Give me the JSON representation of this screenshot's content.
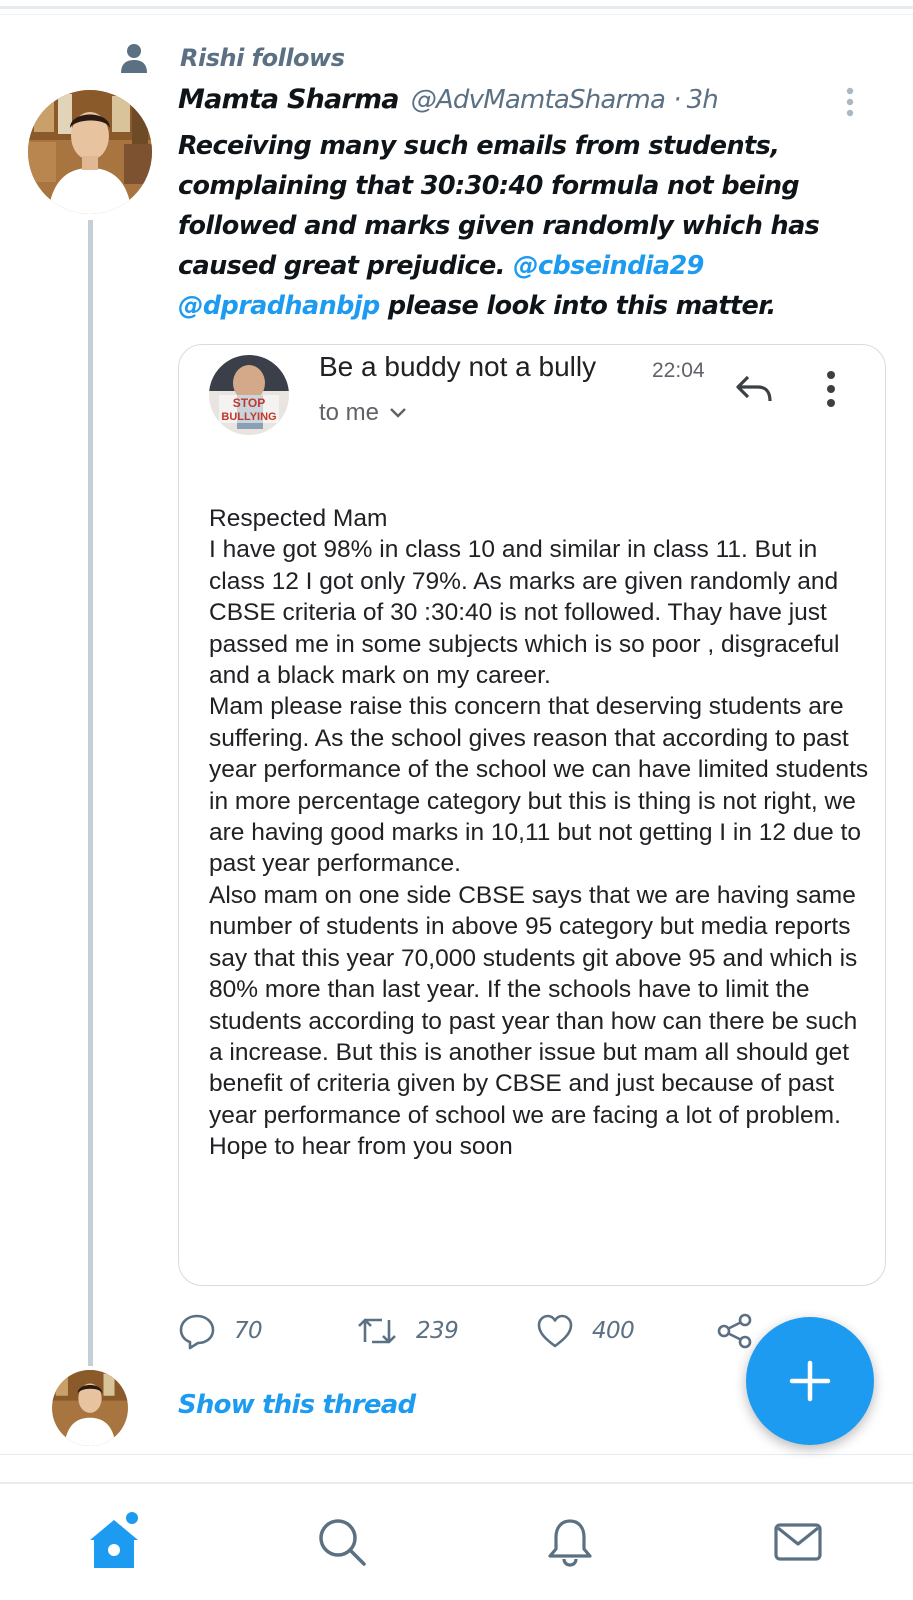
{
  "social_context": {
    "text": "Rishi follows",
    "icon": "person-icon"
  },
  "tweet": {
    "author_name": "Mamta Sharma",
    "author_handle": "@AdvMamtaSharma",
    "separator": "·",
    "time": "3h",
    "text_before": "Receiving many such emails from students, complaining that 30:30:40 formula not being followed and marks given randomly which has caused great prejudice. ",
    "mention_1": "@cbseindia29",
    "text_between": " ",
    "mention_2": "@dpradhanbjp",
    "text_after": " please look into this matter.",
    "accent_color": "#1d9bf0"
  },
  "email_card": {
    "avatar_text_line1": "STOP",
    "avatar_text_line2": "BULLYING",
    "subject": "Be a buddy not a bully",
    "time": "22:04",
    "to": "to me",
    "body": [
      "Respected Mam",
      "I have got 98% in class 10 and similar in class 11. But in class 12 I got only 79%. As marks are given randomly and CBSE criteria of 30 :30:40 is not followed. Thay have just passed me in some subjects which is so poor , disgraceful and a black mark on my career.",
      "Mam please raise this concern that deserving students are suffering. As the school gives reason that according to past year performance of the school we can have limited students in more percentage category but this is thing is not right, we are having good marks in 10,11 but not getting I in 12 due to past year performance.",
      "Also mam on one side CBSE says that we are having same number of students in above 95 category but media reports say that this year 70,000 students git above 95 and which is 80% more than last year. If the schools have to limit the students according to past year than how can there be such a increase. But this is another issue but mam all should get benefit of criteria given by CBSE and just because of past year performance of school we are facing a lot of problem.",
      "Hope to hear from you soon"
    ]
  },
  "actions": {
    "replies": "70",
    "retweets": "239",
    "likes": "400"
  },
  "show_thread": "Show this thread",
  "nav": {
    "items": [
      "home",
      "search",
      "notifications",
      "messages"
    ]
  }
}
